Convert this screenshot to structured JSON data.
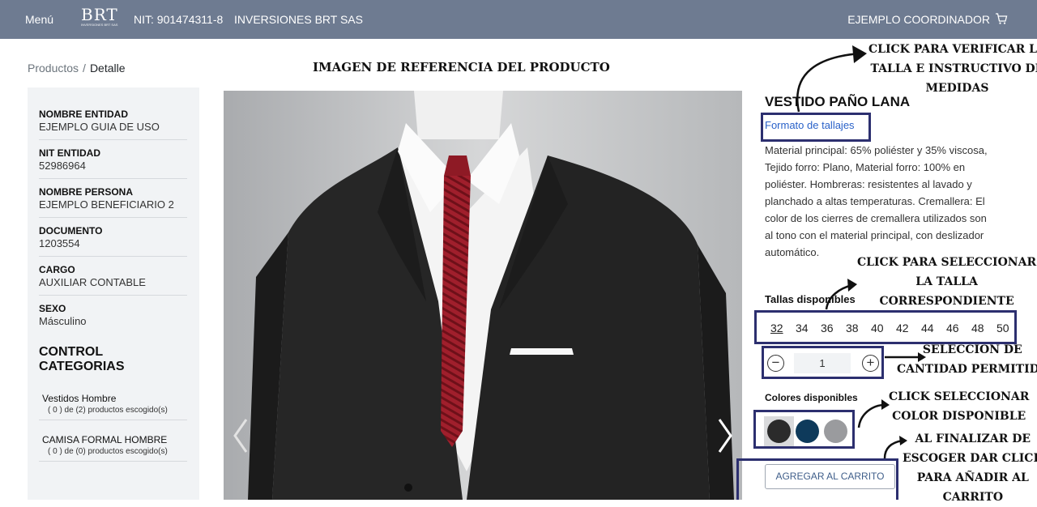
{
  "header": {
    "menu_label": "Menú",
    "logo_text": "BRT",
    "logo_subtext": "INVERSIONES BRT SAS",
    "nit": "NIT: 901474311-8",
    "company": "INVERSIONES BRT SAS",
    "user": "EJEMPLO COORDINADOR",
    "cart_icon": "shopping-cart-icon"
  },
  "breadcrumb": {
    "root": "Productos",
    "separator": "/",
    "current": "Detalle"
  },
  "sidebar": {
    "fields": [
      {
        "label": "NOMBRE ENTIDAD",
        "value": "EJEMPLO GUIA DE USO"
      },
      {
        "label": "NIT ENTIDAD",
        "value": "52986964"
      },
      {
        "label": "NOMBRE PERSONA",
        "value": "EJEMPLO BENEFICIARIO 2"
      },
      {
        "label": "DOCUMENTO",
        "value": "1203554"
      },
      {
        "label": "CARGO",
        "value": "AUXILIAR CONTABLE"
      },
      {
        "label": "SEXO",
        "value": "Másculino"
      }
    ],
    "categories_title": "CONTROL CATEGORIAS",
    "categories": [
      {
        "name": "Vestidos Hombre",
        "count": "( 0 ) de (2) productos escogido(s)"
      },
      {
        "name": "CAMISA FORMAL HOMBRE",
        "count": "( 0 ) de (0) productos escogido(s)"
      }
    ]
  },
  "reference_title": "IMAGEN DE REFERENCIA DEL PRODUCTO",
  "product": {
    "title": "VESTIDO PAÑO LANA",
    "size_format_link": "Formato de tallajes",
    "description": "Material principal: 65% poliéster y 35% viscosa, Tejido forro: Plano, Material forro: 100% en poliéster. Hombreras: resistentes al lavado y planchado a altas temperaturas. Cremallera: El color de los cierres de cremallera utilizados son al tono con el material principal, con deslizador automático.",
    "sizes_label": "Tallas disponibles",
    "sizes": [
      "32",
      "34",
      "36",
      "38",
      "40",
      "42",
      "44",
      "46",
      "48",
      "50"
    ],
    "selected_size": "32",
    "quantity": "1",
    "colors_label": "Colores disponibles",
    "colors": [
      "#2b2b2b",
      "#0e3a5b",
      "#9a9b9e"
    ],
    "add_to_cart": "AGREGAR AL CARRITO"
  },
  "annotations": {
    "size_guide": [
      "CLICK PARA VERIFICAR LA",
      "TALLA E INSTRUCTIVO DE",
      "MEDIDAS"
    ],
    "select_size": [
      "CLICK PARA SELECCIONAR",
      "LA TALLA",
      "CORRESPONDIENTE"
    ],
    "quantity": [
      "SELECCION DE",
      "CANTIDAD PERMITIDA"
    ],
    "color": [
      "CLICK SELECCIONAR",
      "COLOR DISPONIBLE"
    ],
    "cart": [
      "AL FINALIZAR DE",
      "ESCOGER DAR CLICK",
      "PARA AÑADIR AL",
      "CARRITO"
    ]
  },
  "colors": {
    "header_bg": "#6e7b91",
    "highlight_box": "#2c2f6f",
    "link": "#2a62c9"
  }
}
